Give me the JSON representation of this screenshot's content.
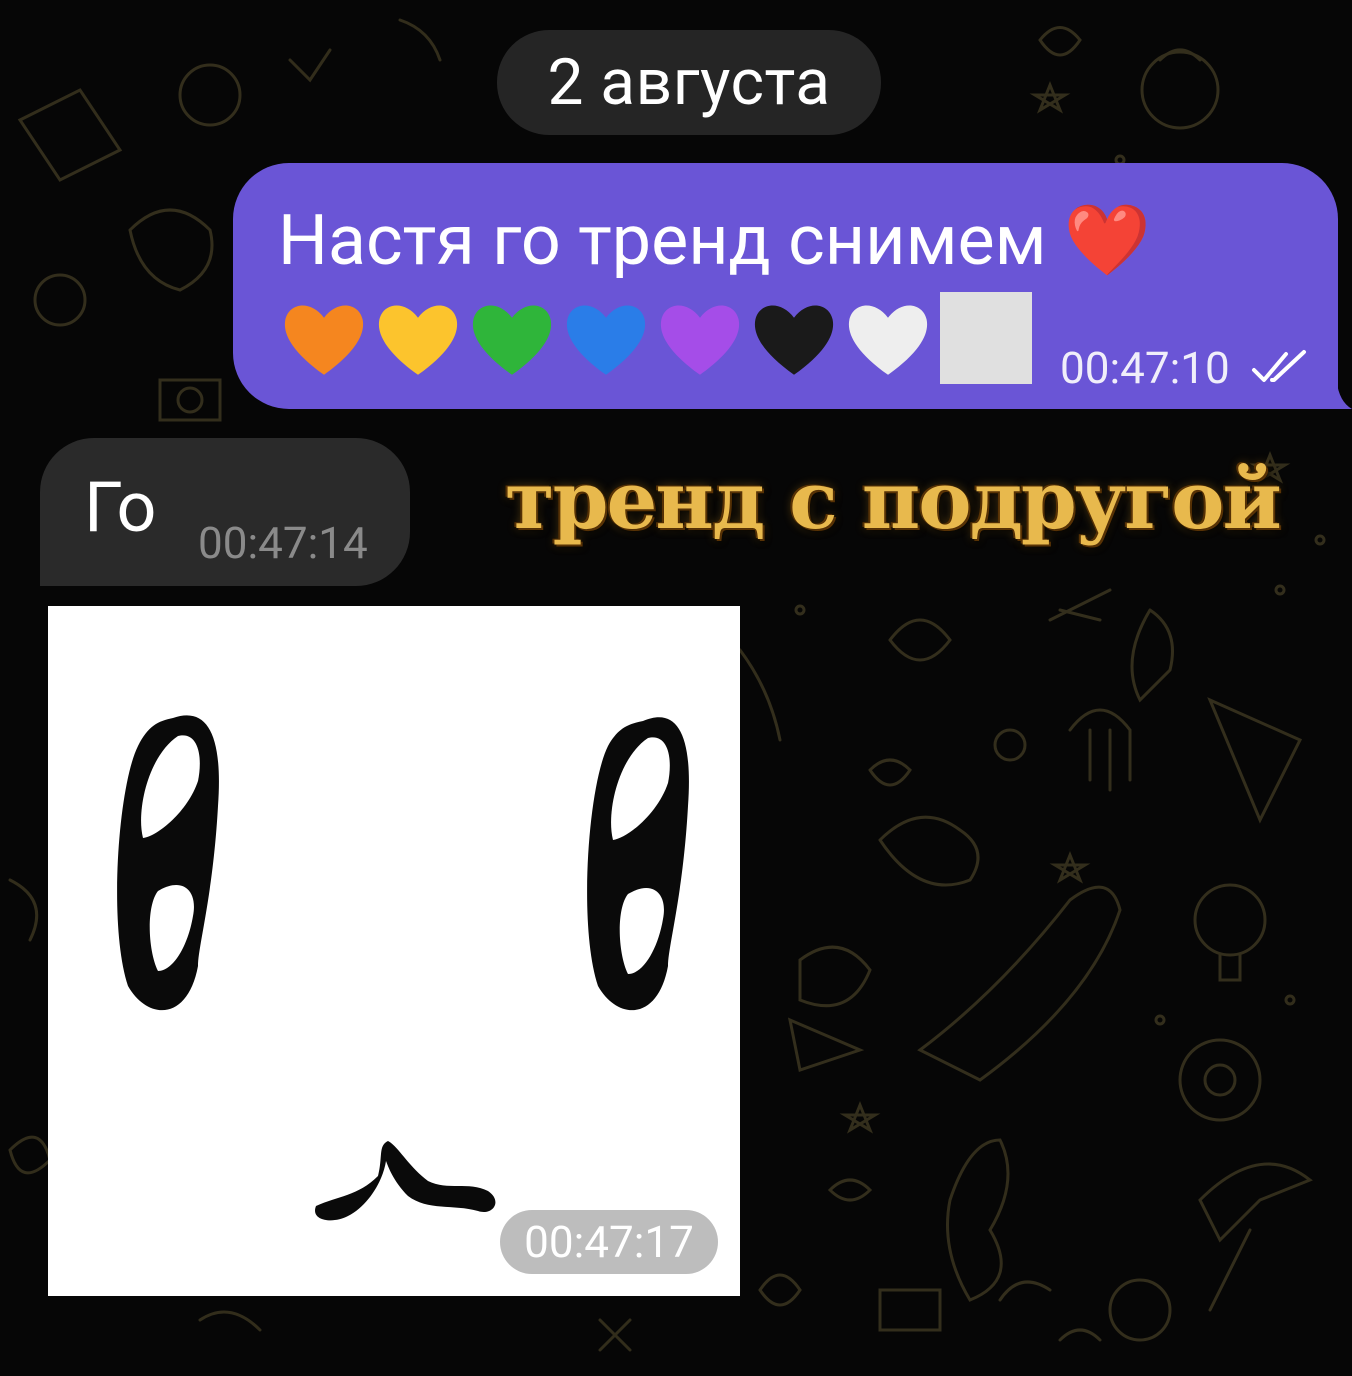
{
  "chat": {
    "date_separator": "2 августа",
    "messages": [
      {
        "direction": "outgoing",
        "text": "Настя го тренд снимем ❤️",
        "emojis": [
          "orange-heart",
          "yellow-heart",
          "green-heart",
          "blue-heart",
          "purple-heart",
          "black-heart",
          "white-heart",
          "white-square"
        ],
        "time": "00:47:10",
        "status_icon": "double-check-icon",
        "bubble_color": "#6a55d6"
      },
      {
        "direction": "incoming",
        "text": "Го",
        "time": "00:47:14",
        "bubble_color": "#2a2a2a"
      },
      {
        "direction": "incoming",
        "type": "sticker",
        "sticker_description": "cute-face-sticker",
        "time": "00:47:17"
      }
    ]
  },
  "overlay": {
    "caption": "тренд с подругой",
    "color": "#e8b94d"
  },
  "colors": {
    "background": "#060606",
    "doodle": "#3a3520",
    "outgoing_bubble": "#6a55d6",
    "incoming_bubble": "#2a2a2a"
  }
}
